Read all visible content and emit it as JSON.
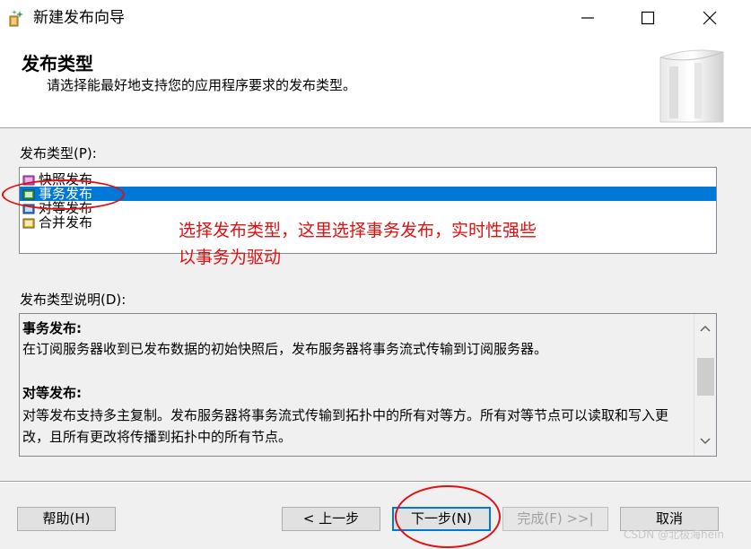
{
  "window": {
    "title": "新建发布向导",
    "controls": [
      "minimize-icon",
      "maximize-icon",
      "close-icon"
    ]
  },
  "header": {
    "title": "发布类型",
    "subtitle": "请选择能最好地支持您的应用程序要求的发布类型。"
  },
  "publication_types": {
    "label": "发布类型(P):",
    "items": [
      {
        "label": "快照发布",
        "icon": "snapshot-publication-icon",
        "selected": false
      },
      {
        "label": "事务发布",
        "icon": "transactional-publication-icon",
        "selected": true
      },
      {
        "label": "对等发布",
        "icon": "peer-to-peer-publication-icon",
        "selected": false
      },
      {
        "label": "合并发布",
        "icon": "merge-publication-icon",
        "selected": false
      }
    ]
  },
  "annotation": {
    "line1": "选择发布类型，这里选择事务发布，实时性强些",
    "line2": "以事务为驱动",
    "color": "#e11010"
  },
  "description": {
    "label": "发布类型说明(D):",
    "sections": [
      {
        "title": "事务发布:",
        "text": "在订阅服务器收到已发布数据的初始快照后，发布服务器将事务流式传输到订阅服务器。"
      },
      {
        "title": "对等发布:",
        "text": "对等发布支持多主复制。发布服务器将事务流式传输到拓扑中的所有对等方。所有对等节点可以读取和写入更改，且所有更改将传播到拓扑中的所有节点。"
      }
    ]
  },
  "buttons": {
    "help": "帮助(H)",
    "prev": "< 上一步",
    "next": "下一步(N)",
    "finish": "完成(F) >>|",
    "cancel": "取消"
  },
  "watermark": "CSDN @北极海hein",
  "colors": {
    "selection": "#0078d7",
    "annotation_red": "#e01010"
  }
}
